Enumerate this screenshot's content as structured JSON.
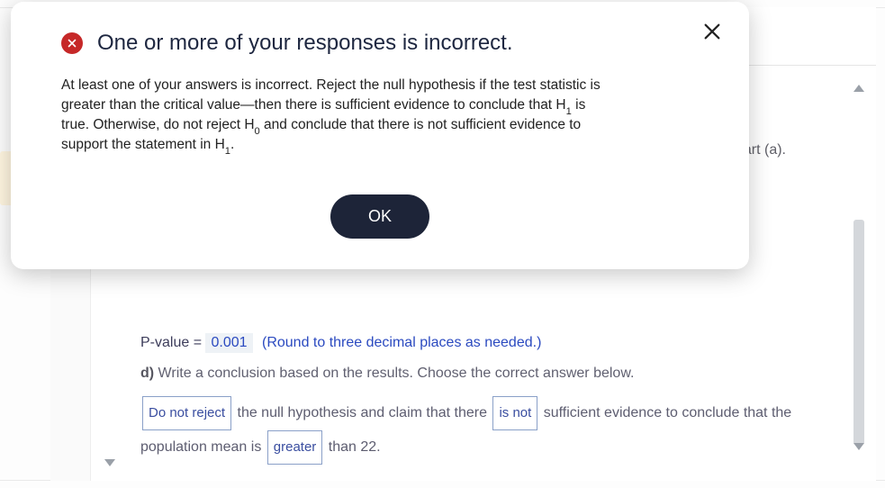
{
  "modal": {
    "title": "One or more of your responses is incorrect.",
    "body_parts": {
      "p1": "At least one of your answers is incorrect. Reject the null hypothesis if the test statistic is greater than the critical value—then there is sufficient evidence to conclude that H",
      "s1": "1",
      "p2": " is true. Otherwise, do not reject H",
      "s0": "0",
      "p3": " and conclude that there is not sufficient evidence to support the statement in H",
      "s1b": "1",
      "p4": "."
    },
    "ok": "OK"
  },
  "background": {
    "part_a_fragment": "s in part (a).",
    "pvalue": {
      "label": "P-value = ",
      "value": "0.001",
      "hint": "(Round to three decimal places as needed.)"
    },
    "question_d": {
      "label": "d)",
      "text": " Write a conclusion based on the results. Choose the correct answer below."
    },
    "conclusion": {
      "sel1": "Do not reject",
      "t1": " the null hypothesis and claim that there ",
      "sel2": "is not",
      "t2": " sufficient evidence to conclude that the population mean is ",
      "sel3": "greater",
      "t3": " than 22."
    }
  }
}
